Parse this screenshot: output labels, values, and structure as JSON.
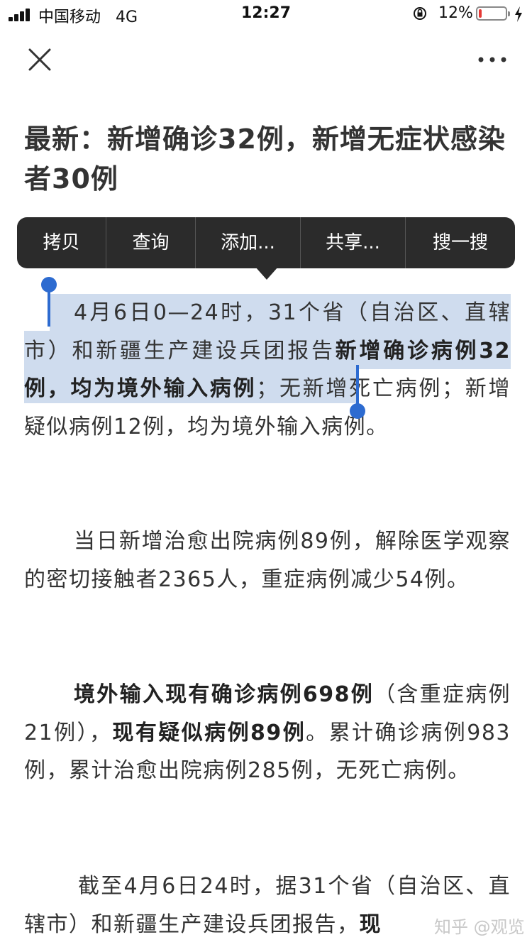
{
  "status_bar": {
    "carrier": "中国移动",
    "network": "4G",
    "time": "12:27",
    "battery_percent": "12%",
    "battery_level": 0.12,
    "battery_color": "#e53935"
  },
  "nav": {
    "close_icon": "close-icon",
    "more_icon": "more-dots-icon"
  },
  "article": {
    "title": "最新：新增确诊32例，新增无症状感染者30例",
    "paragraphs": [
      {
        "p1a": "4月6日0—24时，31个省（自治区、直辖市）和新疆生产建设兵团报告",
        "p1b": "新增确诊病例32例，均为境外输入病例",
        "p1c": "；",
        "p1d": "无新增死亡病例；新增疑似病例12例，均为境外输入病例。"
      },
      {
        "text": "当日新增治愈出院病例89例，解除医学观察的密切接触者2365人，重症病例减少54例。"
      },
      {
        "p3a": "境外输入现有确诊病例698例",
        "p3b": "（含重症病例21例）",
        "p3c": "，",
        "p3d": "现有疑似病例89例",
        "p3e": "。累计确诊病例983例，累计治愈出院病例285例，无死亡病例。"
      },
      {
        "p4a": "截至4月6日24时，据31个省（自治区、直辖市）和新疆生产建设兵团报告，",
        "p4b": "现"
      }
    ]
  },
  "context_menu": {
    "items": [
      "拷贝",
      "查询",
      "添加...",
      "共享...",
      "搜一搜"
    ],
    "background": "#2b2b2b"
  },
  "selection": {
    "highlight_color": "#cfdcee",
    "handle_color": "#2d6bd0"
  },
  "watermark": "知乎 @观览"
}
